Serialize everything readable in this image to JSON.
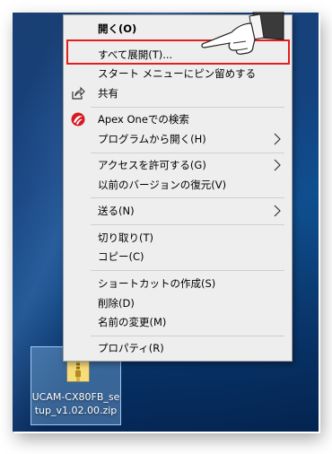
{
  "context_menu": {
    "items": [
      {
        "label": "開く(O)"
      },
      {
        "label": "すべて展開(T)..."
      },
      {
        "label": "スタート メニューにピン留めする"
      },
      {
        "label": "共有"
      },
      {
        "label": "Apex Oneでの検索"
      },
      {
        "label": "プログラムから開く(H)"
      },
      {
        "label": "アクセスを許可する(G)"
      },
      {
        "label": "以前のバージョンの復元(V)"
      },
      {
        "label": "送る(N)"
      },
      {
        "label": "切り取り(T)"
      },
      {
        "label": "コピー(C)"
      },
      {
        "label": "ショートカットの作成(S)"
      },
      {
        "label": "削除(D)"
      },
      {
        "label": "名前の変更(M)"
      },
      {
        "label": "プロパティ(R)"
      }
    ]
  },
  "desktop_file": {
    "name": "UCAM-CX80FB_se\ntup_v1.02.00.zip",
    "icon": "zip-folder-icon"
  },
  "colors": {
    "highlight": "#e0201c",
    "menu_bg": "#eeeeee",
    "desktop": "#0f4f8f"
  }
}
